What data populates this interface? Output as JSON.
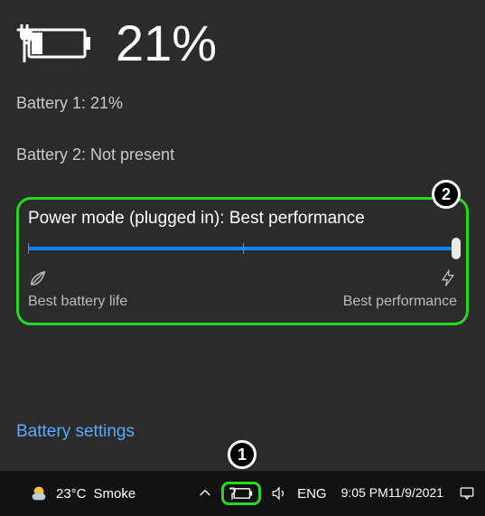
{
  "header": {
    "percent": "21%"
  },
  "batteries": {
    "line1": "Battery 1: 21%",
    "line2": "Battery 2: Not present"
  },
  "power": {
    "label": "Power mode (plugged in): Best performance",
    "left_caption": "Best battery life",
    "right_caption": "Best performance",
    "slider_value": 100
  },
  "link": {
    "settings": "Battery settings"
  },
  "taskbar": {
    "temp": "23°C",
    "condition": "Smoke",
    "lang": "ENG",
    "time": "9:05 PM",
    "date": "11/9/2021"
  },
  "annotations": {
    "a1": "1",
    "a2": "2"
  }
}
